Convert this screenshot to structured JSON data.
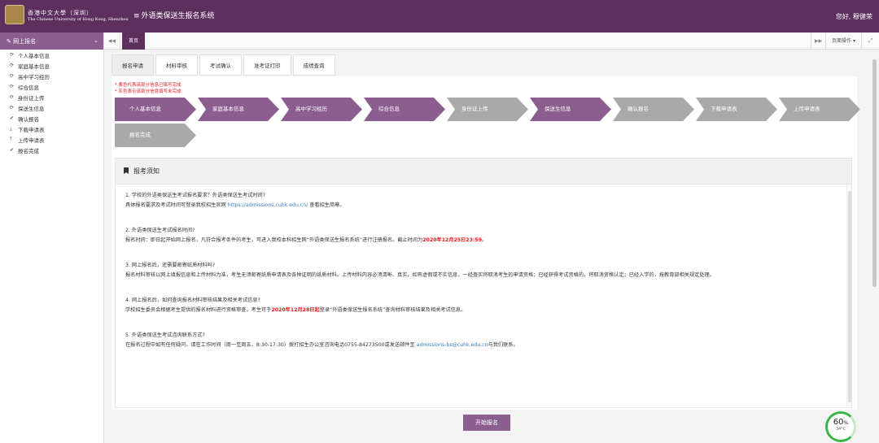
{
  "header": {
    "logo_cn": "香港中文大學（深圳）",
    "logo_en": "The Chinese University of Hong Kong, Shenzhen",
    "system_title": "外语类保送生报名系统",
    "greeting": "您好, 穆健荣"
  },
  "sidebar": {
    "section_title": "网上报名",
    "items": [
      {
        "label": "个人基本信息",
        "icon": "refresh-icon"
      },
      {
        "label": "家庭基本信息",
        "icon": "refresh-icon"
      },
      {
        "label": "高中学习经历",
        "icon": "refresh-icon"
      },
      {
        "label": "综合信息",
        "icon": "refresh-icon"
      },
      {
        "label": "身份证上传",
        "icon": "refresh-icon"
      },
      {
        "label": "保送生信息",
        "icon": "refresh-icon"
      },
      {
        "label": "确认报名",
        "icon": "check-icon"
      },
      {
        "label": "下载申请表",
        "icon": "download-icon"
      },
      {
        "label": "上传申请表",
        "icon": "upload-icon"
      },
      {
        "label": "报名完成",
        "icon": "check-icon"
      }
    ]
  },
  "tabbar": {
    "home": "首页",
    "page_ops": "页面操作"
  },
  "subtabs": [
    "报名申请",
    "材料审核",
    "考试确认",
    "准考证打印",
    "成绩查询"
  ],
  "notes": {
    "line1": "* 紫色代表该部分信息已填写完成",
    "line2": "* 灰色表示该部分信息填写未完成"
  },
  "steps": [
    {
      "label": "个人基本信息",
      "status": "done"
    },
    {
      "label": "家庭基本信息",
      "status": "done"
    },
    {
      "label": "高中学习经历",
      "status": "done"
    },
    {
      "label": "综合信息",
      "status": "done"
    },
    {
      "label": "身份证上传",
      "status": "todo"
    },
    {
      "label": "保送生信息",
      "status": "done"
    },
    {
      "label": "确认报名",
      "status": "todo"
    },
    {
      "label": "下载申请表",
      "status": "todo"
    },
    {
      "label": "上传申请表",
      "status": "todo"
    },
    {
      "label": "报名完成",
      "status": "todo"
    }
  ],
  "notice": {
    "title": "报考须知",
    "q1": "1. 学校的外语类保送生考试报名要求？外语类保送生考试时间?",
    "a1_pre": "具体报名要求及考试时间可登录我校招生官网 ",
    "a1_link": "https://admissions.cuhk.edu.cn/",
    "a1_post": " 查看招生简章。",
    "q2": "2. 外语类保送生考试报名时间?",
    "a2_pre": "报名时间：即日起开始网上报名，凡符合报考条件的考生，可进入我校本科招生网“外语类保送生报名系统”进行注册报名。截止时间为",
    "a2_red": "2020年12月25日23:59",
    "a2_post": "。",
    "q3": "3. 网上报名后，还需要邮寄纸质材料吗?",
    "a3": "报名材料审核以网上填报信息和上传材料为准，考生无须邮寄纸质申请表及各种证明的纸质材料。上传材料内容必须清晰、真实。如有虚假或不实信息，一经查实将取消考生的申请资格；已经获得考试资格的，将取消资格认定；已经入学的，按教育部相关规定处理。",
    "q4": "4. 网上报名后，如何查询报名材料审核结果及相关考试信息?",
    "a4_pre": "学校招生委员会根据考生提供的报名材料进行资格审查。考生可于",
    "a4_red": "2020年12月28日起",
    "a4_post": "登录“外语类保送生报名系统”查询材料审核结果及相关考试信息。",
    "q5": "5. 外语类保送生考试咨询联系方式?",
    "a5_pre": "在报名过程中如有任何疑问，请在工作时间（周一至周五，8:30-17:30）拨打招生办公室咨询电话0755-84273500或发送邮件至 ",
    "a5_link": "admissions-bs@cuhk.edu.cn",
    "a5_post": "与我们联系。"
  },
  "start_button": "开始报名",
  "gauge": {
    "percent": "60",
    "unit": "%",
    "temp": "34°C"
  },
  "colors": {
    "header": "#5c2f5e",
    "done": "#8b5e8f",
    "todo": "#a9a9a9",
    "accent_red": "#e31a1a",
    "link": "#3a7bbf"
  }
}
